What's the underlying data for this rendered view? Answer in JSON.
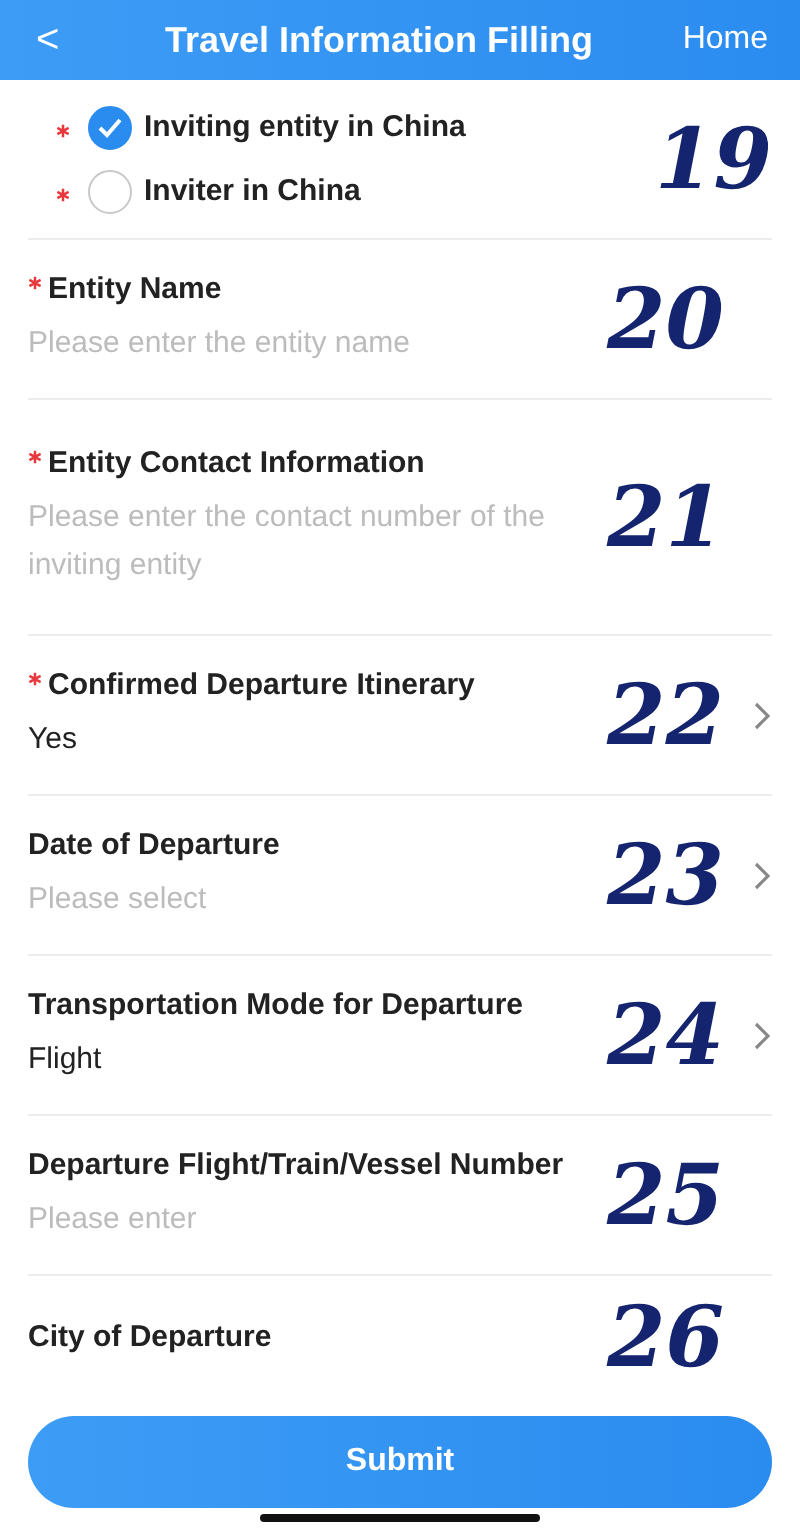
{
  "header": {
    "back": "<",
    "title": "Travel Information Filling",
    "home": "Home"
  },
  "sections": [
    {
      "kind": "radio_group",
      "annotation": "19",
      "options": [
        {
          "label": "Inviting entity in China",
          "required": true,
          "selected": true
        },
        {
          "label": "Inviter in China",
          "required": true,
          "selected": false
        }
      ]
    },
    {
      "kind": "field",
      "annotation": "20",
      "label": "Entity Name",
      "required": true,
      "placeholder": "Please enter the entity name",
      "chevron": false
    },
    {
      "kind": "field",
      "annotation": "21",
      "label": "Entity Contact Information",
      "required": true,
      "placeholder": "Please enter the contact number of the inviting entity",
      "chevron": false
    },
    {
      "kind": "field",
      "annotation": "22",
      "label": "Confirmed Departure Itinerary",
      "required": true,
      "value": "Yes",
      "chevron": true
    },
    {
      "kind": "field",
      "annotation": "23",
      "label": "Date of Departure",
      "required": false,
      "placeholder": "Please select",
      "chevron": true
    },
    {
      "kind": "field",
      "annotation": "24",
      "label": "Transportation Mode for Departure",
      "required": false,
      "value": "Flight",
      "chevron": true
    },
    {
      "kind": "field",
      "annotation": "25",
      "label": "Departure Flight/Train/Vessel Number",
      "required": false,
      "placeholder": "Please enter",
      "chevron": false
    },
    {
      "kind": "label_only",
      "annotation": "26",
      "label": "City of Departure",
      "required": false
    }
  ],
  "submit": "Submit"
}
